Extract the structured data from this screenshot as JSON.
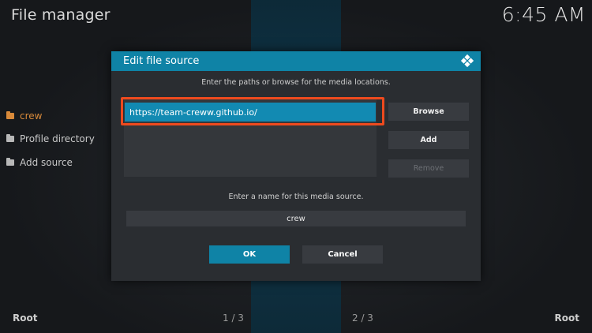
{
  "header": {
    "title": "File manager",
    "clock": "6:45 AM"
  },
  "sidebar": {
    "items": [
      {
        "label": "crew",
        "active": true
      },
      {
        "label": "Profile directory",
        "active": false
      },
      {
        "label": "Add source",
        "active": false
      }
    ]
  },
  "footer": {
    "left": "Root",
    "right": "Root",
    "page_left": "1 / 3",
    "page_right": "2 / 3"
  },
  "dialog": {
    "title": "Edit file source",
    "instruction": "Enter the paths or browse for the media locations.",
    "paths": [
      "https://team-creww.github.io/"
    ],
    "buttons": {
      "browse": "Browse",
      "add": "Add",
      "remove": "Remove"
    },
    "name_label": "Enter a name for this media source.",
    "name_value": "crew",
    "ok": "OK",
    "cancel": "Cancel"
  },
  "colors": {
    "accent": "#0f83a6",
    "selected_path": "#128ab2",
    "highlight_border": "#ee4a1e",
    "active_sidebar": "#d98a3a"
  }
}
